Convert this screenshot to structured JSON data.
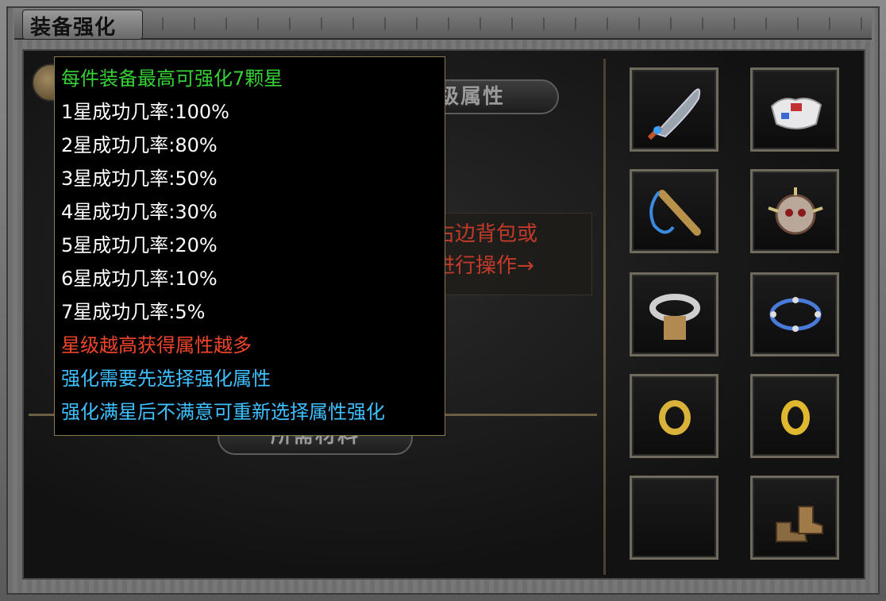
{
  "window": {
    "title": "装备强化"
  },
  "panels": {
    "upgrade_attributes_label": "升级属性",
    "required_materials_label": "所需材料"
  },
  "hint": {
    "line1": "请先选择右边背包或",
    "line2": "佩戴装备进行操作→"
  },
  "tooltip": {
    "lines": [
      {
        "text": "每件装备最高可强化7颗星",
        "color": "#36d136"
      },
      {
        "text": "1星成功几率:100%",
        "color": "#ffffff"
      },
      {
        "text": "2星成功几率:80%",
        "color": "#ffffff"
      },
      {
        "text": "3星成功几率:50%",
        "color": "#ffffff"
      },
      {
        "text": "4星成功几率:30%",
        "color": "#ffffff"
      },
      {
        "text": "5星成功几率:20%",
        "color": "#ffffff"
      },
      {
        "text": "6星成功几率:10%",
        "color": "#ffffff"
      },
      {
        "text": "7星成功几率:5%",
        "color": "#ffffff"
      },
      {
        "text": "星级越高获得属性越多",
        "color": "#f0452a"
      },
      {
        "text": "强化需要先选择强化属性",
        "color": "#3ec0ff"
      },
      {
        "text": "强化满星后不满意可重新选择属性强化",
        "color": "#3ec0ff"
      }
    ]
  },
  "equipment_slots": [
    {
      "item": "sword-icon"
    },
    {
      "item": "armor-icon"
    },
    {
      "item": "necklace-icon"
    },
    {
      "item": "helmet-icon"
    },
    {
      "item": "bracelet-icon"
    },
    {
      "item": "blue-bracelet-icon"
    },
    {
      "item": "ring-icon"
    },
    {
      "item": "ring-icon"
    },
    {
      "item": ""
    },
    {
      "item": "boots-icon"
    }
  ]
}
